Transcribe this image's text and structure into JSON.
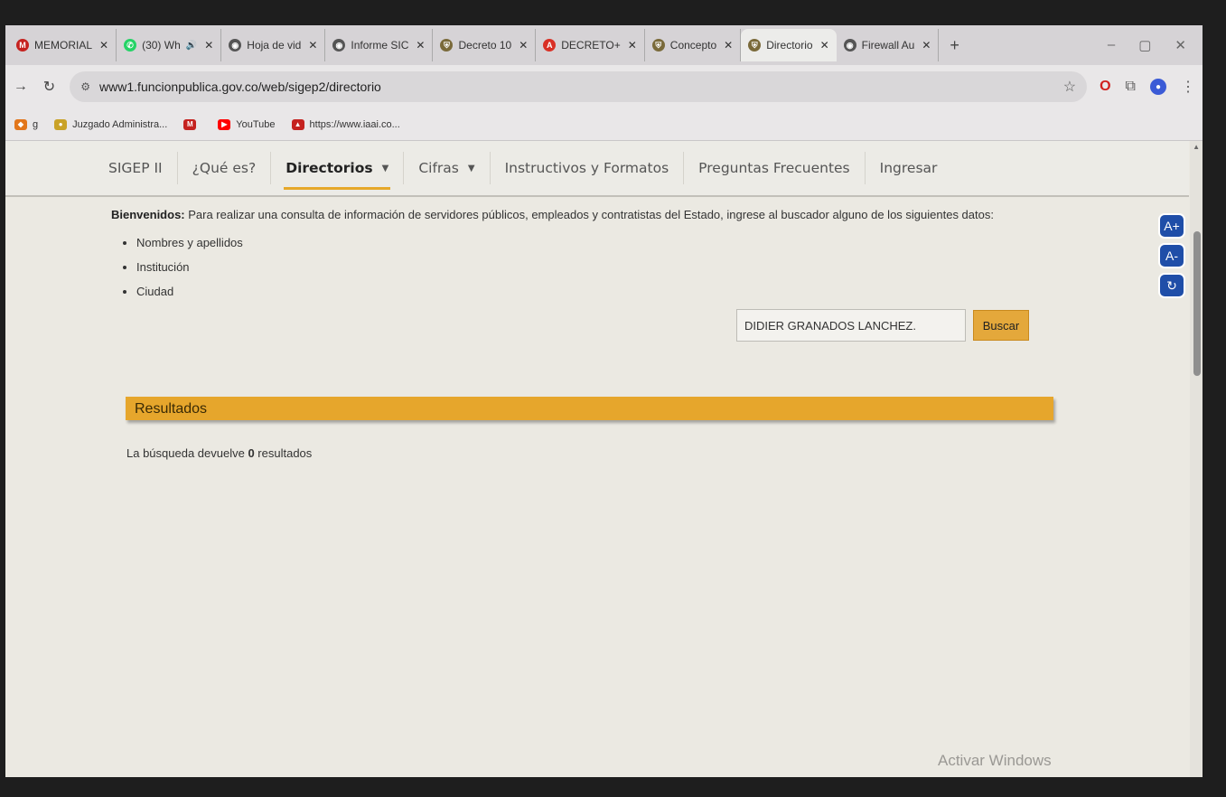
{
  "tabs": [
    {
      "label": "MEMORIAL",
      "icon": "gmail-icon",
      "color": "#c5221f"
    },
    {
      "label": "(30) Wh",
      "icon": "whatsapp-icon",
      "color": "#25d366",
      "extra": "🔊"
    },
    {
      "label": "Hoja de vid",
      "icon": "globe-icon",
      "color": "#555555"
    },
    {
      "label": "Informe SIC",
      "icon": "globe-icon",
      "color": "#555555"
    },
    {
      "label": "Decreto 10",
      "icon": "shield-icon",
      "color": "#7a6a3a"
    },
    {
      "label": "DECRETO+",
      "icon": "pdf-icon",
      "color": "#d93025"
    },
    {
      "label": "Concepto",
      "icon": "shield-icon",
      "color": "#7a6a3a"
    },
    {
      "label": "Directorio",
      "icon": "shield-icon",
      "color": "#7a6a3a",
      "active": true
    },
    {
      "label": "Firewall Au",
      "icon": "globe-icon",
      "color": "#555555"
    }
  ],
  "address": {
    "url": "www1.funcionpublica.gov.co/web/sigep2/directorio"
  },
  "bookmarks": [
    {
      "label": "g",
      "icon": "metamask-icon",
      "color": "#e2761b"
    },
    {
      "label": "Juzgado Administra...",
      "icon": "seal-icon",
      "color": "#c9a227"
    },
    {
      "label": "",
      "icon": "gmail-icon",
      "color": "#c5221f"
    },
    {
      "label": "YouTube",
      "icon": "youtube-icon",
      "color": "#ff0000"
    },
    {
      "label": "https://www.iaai.co...",
      "icon": "iaai-icon",
      "color": "#c5221f"
    }
  ],
  "nav": {
    "items": [
      {
        "label": "SIGEP II"
      },
      {
        "label": "¿Qué es?"
      },
      {
        "label": "Directorios",
        "active": true,
        "caret": true
      },
      {
        "label": "Cifras",
        "caret": true
      },
      {
        "label": "Instructivos y Formatos"
      },
      {
        "label": "Preguntas Frecuentes"
      },
      {
        "label": "Ingresar"
      }
    ]
  },
  "intro": {
    "bold": "Bienvenidos:",
    "text": " Para realizar una consulta de información de servidores públicos, empleados y contratistas del Estado, ingrese al buscador alguno de los siguientes datos:",
    "list": [
      "Nombres y apellidos",
      "Institución",
      "Ciudad"
    ]
  },
  "search": {
    "value": "DIDIER GRANADOS LANCHEZ.",
    "button": "Buscar"
  },
  "a11y": {
    "increase": "A+",
    "decrease": "A-",
    "reset": "↻"
  },
  "results": {
    "title": "Resultados",
    "count_prefix": "La búsqueda devuelve ",
    "count": "0",
    "count_suffix": " resultados"
  },
  "watermark": "Activar Windows"
}
